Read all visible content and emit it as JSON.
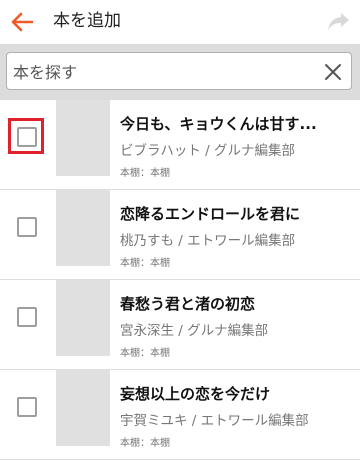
{
  "header": {
    "title": "本を追加",
    "back_icon": "arrow-left-icon",
    "share_icon": "share-icon",
    "accent_color": "#f15a24"
  },
  "search": {
    "placeholder": "本を探す",
    "value": "",
    "clear_icon": "close-icon"
  },
  "books": [
    {
      "title": "今日も、キョウくんは甘す...",
      "author": "ビブラハット / グルナ編集部",
      "shelf": "本棚：本棚",
      "checked": false,
      "highlighted": true
    },
    {
      "title": "恋降るエンドロールを君に",
      "author": "桃乃すも / エトワール編集部",
      "shelf": "本棚：本棚",
      "checked": false,
      "highlighted": false
    },
    {
      "title": "春愁う君と渚の初恋",
      "author": "宮永深生 / グルナ編集部",
      "shelf": "本棚：本棚",
      "checked": false,
      "highlighted": false
    },
    {
      "title": "妄想以上の恋を今だけ",
      "author": "宇賀ミユキ / エトワール編集部",
      "shelf": "本棚：本棚",
      "checked": false,
      "highlighted": false
    }
  ]
}
